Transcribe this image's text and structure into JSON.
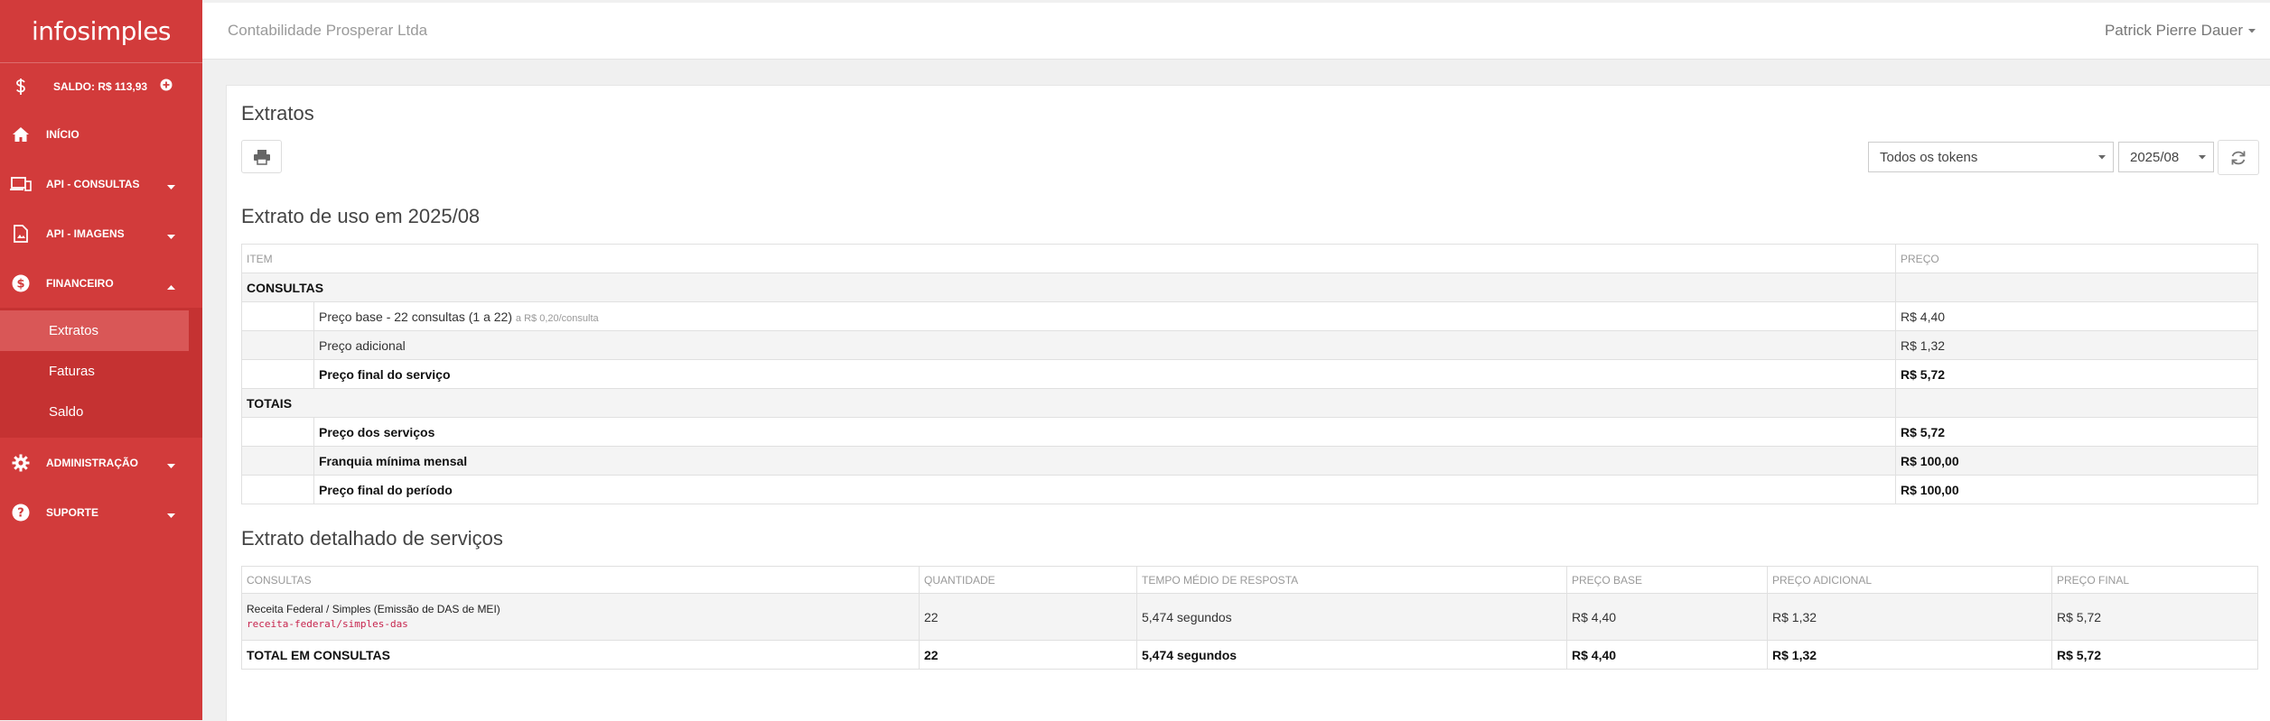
{
  "app": {
    "logo": "infosimples"
  },
  "sidebar": {
    "balance_label": "SALDO: R$ 113,93",
    "items": [
      {
        "label": "INÍCIO",
        "icon": "home-icon"
      },
      {
        "label": "API - CONSULTAS",
        "icon": "devices-icon"
      },
      {
        "label": "API - IMAGENS",
        "icon": "image-doc-icon"
      },
      {
        "label": "FINANCEIRO",
        "icon": "dollar-circle-icon"
      },
      {
        "label": "ADMINISTRAÇÃO",
        "icon": "gear-icon"
      },
      {
        "label": "SUPORTE",
        "icon": "help-icon"
      }
    ],
    "sub_items": [
      "Extratos",
      "Faturas",
      "Saldo"
    ]
  },
  "topbar": {
    "company": "Contabilidade Prosperar Ltda",
    "user": "Patrick Pierre Dauer"
  },
  "page": {
    "title": "Extratos",
    "token_select": "Todos os tokens",
    "period_select": "2025/08"
  },
  "usage": {
    "title": "Extrato de uso em 2025/08",
    "headers": {
      "item": "ITEM",
      "price": "PREÇO"
    },
    "section_consultas": "CONSULTAS",
    "rows": [
      {
        "label": "Preço base - 22 consultas (1 a 22)",
        "note": "a R$ 0,20/consulta",
        "price": "R$ 4,40"
      },
      {
        "label": "Preço adicional",
        "price": "R$ 1,32"
      },
      {
        "label": "Preço final do serviço",
        "price": "R$ 5,72"
      }
    ],
    "section_totais": "TOTAIS",
    "totals": [
      {
        "label": "Preço dos serviços",
        "price": "R$ 5,72"
      },
      {
        "label": "Franquia mínima mensal",
        "price": "R$ 100,00"
      },
      {
        "label": "Preço final do período",
        "price": "R$ 100,00"
      }
    ]
  },
  "detail": {
    "title": "Extrato detalhado de serviços",
    "headers": {
      "consultas": "CONSULTAS",
      "quantidade": "QUANTIDADE",
      "tempo": "TEMPO MÉDIO DE RESPOSTA",
      "preco_base": "PREÇO BASE",
      "preco_adicional": "PREÇO ADICIONAL",
      "preco_final": "PREÇO FINAL"
    },
    "row": {
      "name": "Receita Federal / Simples (Emissão de DAS de MEI)",
      "code": "receita-federal/simples-das",
      "quantidade": "22",
      "tempo": "5,474 segundos",
      "preco_base": "R$ 4,40",
      "preco_adicional": "R$ 1,32",
      "preco_final": "R$ 5,72"
    },
    "total": {
      "label": "TOTAL EM CONSULTAS",
      "quantidade": "22",
      "tempo": "5,474 segundos",
      "preco_base": "R$ 4,40",
      "preco_adicional": "R$ 1,32",
      "preco_final": "R$ 5,72"
    }
  },
  "colors": {
    "sidebar": "#d23b3b",
    "sidebar_sub": "#c53232",
    "sub_active": "#d95757",
    "code": "#c7254e"
  }
}
